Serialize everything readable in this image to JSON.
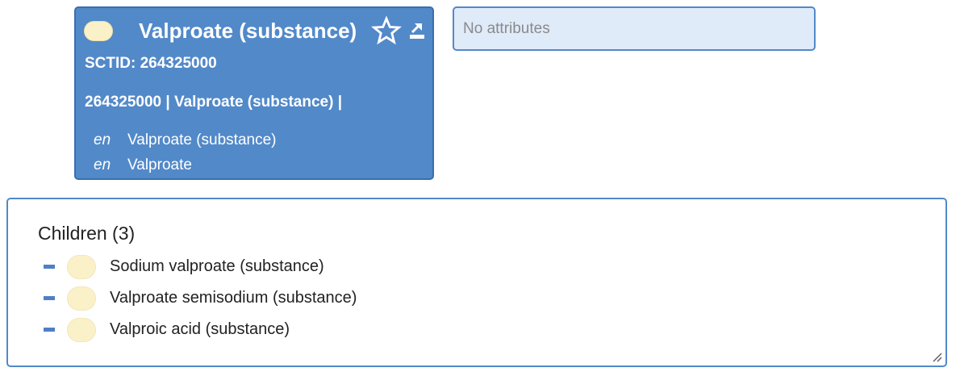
{
  "concept": {
    "title": "Valproate (substance)",
    "sctid_label": "SCTID: 264325000",
    "fsn_line": "264325000 | Valproate (substance) |",
    "descriptions": [
      {
        "lang": "en",
        "term": "Valproate (substance)"
      },
      {
        "lang": "en",
        "term": "Valproate"
      }
    ],
    "icons": {
      "definition_status": "primitive-concept-pill-icon",
      "favorite": "star-outline-icon",
      "export": "export-arrow-icon"
    }
  },
  "attributes": {
    "empty_text": "No attributes"
  },
  "children": {
    "heading": "Children (3)",
    "items": [
      {
        "label": "Sodium valproate (substance)"
      },
      {
        "label": "Valproate semisodium (substance)"
      },
      {
        "label": "Valproic acid (substance)"
      }
    ]
  },
  "colors": {
    "card_background": "#5289c9",
    "card_border": "#3a6fae",
    "attribute_background": "#e0ebf9",
    "primitive_pill": "#fbf1c9",
    "expander": "#4f7fc4"
  }
}
